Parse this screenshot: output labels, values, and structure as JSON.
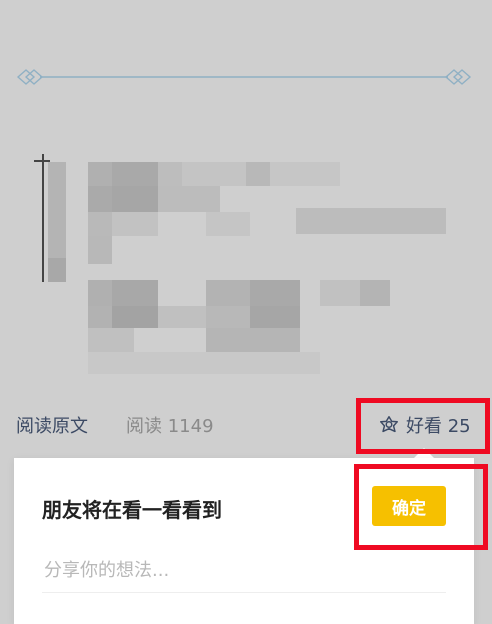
{
  "article": {
    "read_original_label": "阅读原文",
    "read_count_text": "阅读 1149"
  },
  "wow": {
    "icon": "wow-flower-icon",
    "label": "好看 25"
  },
  "popup": {
    "title": "朋友将在看一看看到",
    "confirm_label": "确定",
    "input_placeholder": "分享你的想法..."
  },
  "colors": {
    "accent": "#f6c000",
    "highlight": "#ef0a22",
    "link": "#3c4a64"
  }
}
